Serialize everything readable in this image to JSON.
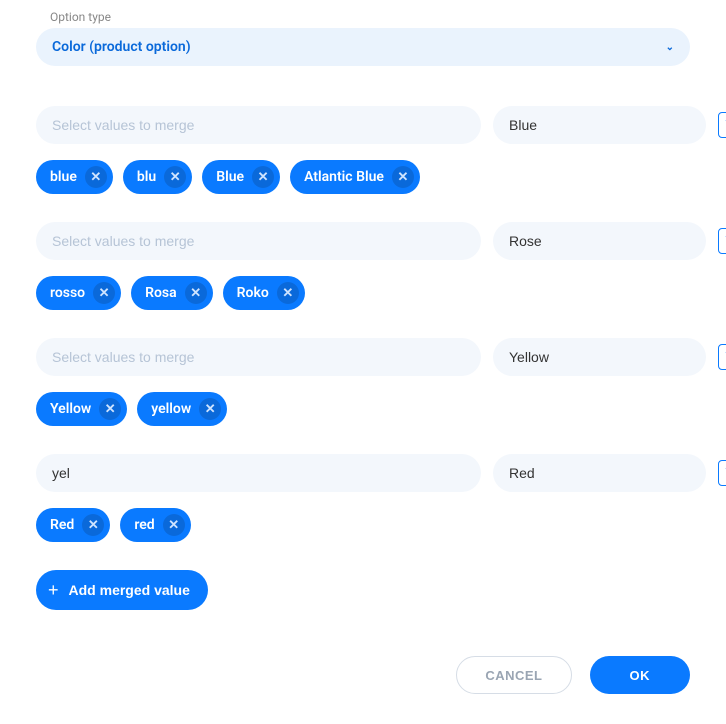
{
  "option_type_label": "Option type",
  "option_type_value": "Color (product option)",
  "merge_placeholder": "Select values to merge",
  "add_button_label": "Add merged value",
  "cancel_label": "CANCEL",
  "ok_label": "OK",
  "groups": [
    {
      "input_value": "",
      "name_value": "Blue",
      "chips": [
        "blue",
        "blu",
        "Blue",
        "Atlantic Blue"
      ]
    },
    {
      "input_value": "",
      "name_value": "Rose",
      "chips": [
        "rosso",
        "Rosa",
        "Roko"
      ]
    },
    {
      "input_value": "",
      "name_value": "Yellow",
      "chips": [
        "Yellow",
        "yellow"
      ]
    },
    {
      "input_value": "yel",
      "name_value": "Red",
      "chips": [
        "Red",
        "red"
      ]
    }
  ]
}
